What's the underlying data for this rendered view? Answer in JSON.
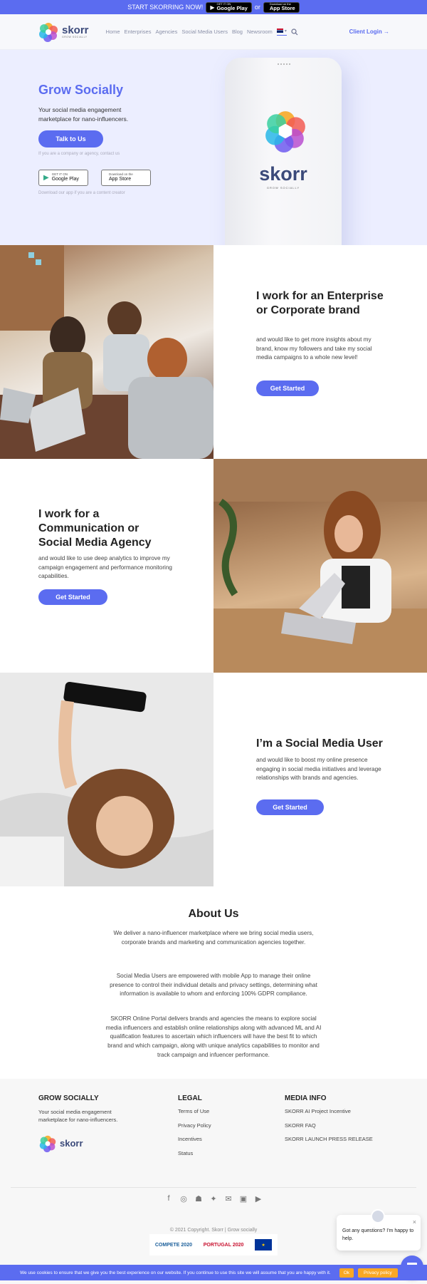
{
  "topbar": {
    "text": "START SKORRING NOW!",
    "or": "or",
    "google": {
      "small": "GET IT ON",
      "big": "Google Play"
    },
    "apple": {
      "small": "Download on the",
      "big": "App Store"
    }
  },
  "header": {
    "logo_text": "skorr",
    "logo_sub": "GROW SOCIALLY",
    "nav": [
      "Home",
      "Enterprises",
      "Agencies",
      "Social Media Users",
      "Blog",
      "Newsroom"
    ],
    "client_login": "Client Login →"
  },
  "hero": {
    "title": "Grow Socially",
    "tagline": "Your social media engagement marketplace for nano-influencers.",
    "talk_button": "Talk to Us",
    "hint_company": "If you are a company or agency, contact us",
    "google": {
      "small": "GET IT ON",
      "big": "Google Play"
    },
    "apple": {
      "small": "Download on the",
      "big": "App Store"
    },
    "hint_app": "Download our app if you are a content creator",
    "phone_word": "skorr",
    "phone_sub": "GROW SOCIALLY"
  },
  "sections": [
    {
      "title": "I work for an Enterprise or Corporate brand",
      "desc": "and would like to get more insights about my brand, know my followers and take my social media campaigns to a whole new level!",
      "button": "Get Started"
    },
    {
      "title": "I work for a Communication or Social Media Agency",
      "desc": "and would like to use deep analytics to improve my campaign engagement and performance monitoring capabilities.",
      "button": "Get Started"
    },
    {
      "title": "I’m a Social Media User",
      "desc": "and would like to boost my online presence engaging in social media initiatives and leverage relationships with brands and agencies.",
      "button": "Get Started"
    }
  ],
  "about": {
    "title": "About Us",
    "p1": "We deliver a nano-influencer marketplace where we bring social media users, corporate brands and marketing and communication agencies together.",
    "p2": "Social Media Users are empowered with mobile App to manage their online presence to control their individual details and privacy settings, determining what information is available to whom and enforcing 100% GDPR compliance.",
    "p3": "SKORR Online Portal delivers brands and agencies the means to explore social media influencers and establish online relationships along with advanced ML and AI qualification features to ascertain which influencers will have the best fit to which brand and which campaign, along with unique analytics capabilities to monitor and track campaign and infuencer performance."
  },
  "footer": {
    "col1": {
      "title": "GROW SOCIALLY",
      "desc": "Your social media engagement marketplace for nano-influencers.",
      "logo_text": "skorr"
    },
    "col2": {
      "title": "LEGAL",
      "links": [
        "Terms of Use",
        "Privacy Policy",
        "Incentives",
        "Status"
      ]
    },
    "col3": {
      "title": "MEDIA INFO",
      "links": [
        "SKORR AI Project Incentive",
        "SKORR FAQ",
        "SKORR LAUNCH PRESS RELEASE"
      ]
    },
    "copyright": "© 2021 Copyright. Skorr | Grow socially",
    "funding": [
      "COMPETE 2020",
      "PORTUGAL 2020"
    ]
  },
  "cookie": {
    "text": "We use cookies to ensure that we give you the best experience on our website. If you continue to use this site we will assume that you are happy with it.",
    "ok": "Ok",
    "policy": "Privacy policy"
  },
  "chat": {
    "text": "Got any questions? I'm happy to help.",
    "close": "×"
  },
  "colors": {
    "accent": "#5b6cf0",
    "hero_bg": "#eceeff",
    "footer_bg": "#f7f7f7"
  }
}
